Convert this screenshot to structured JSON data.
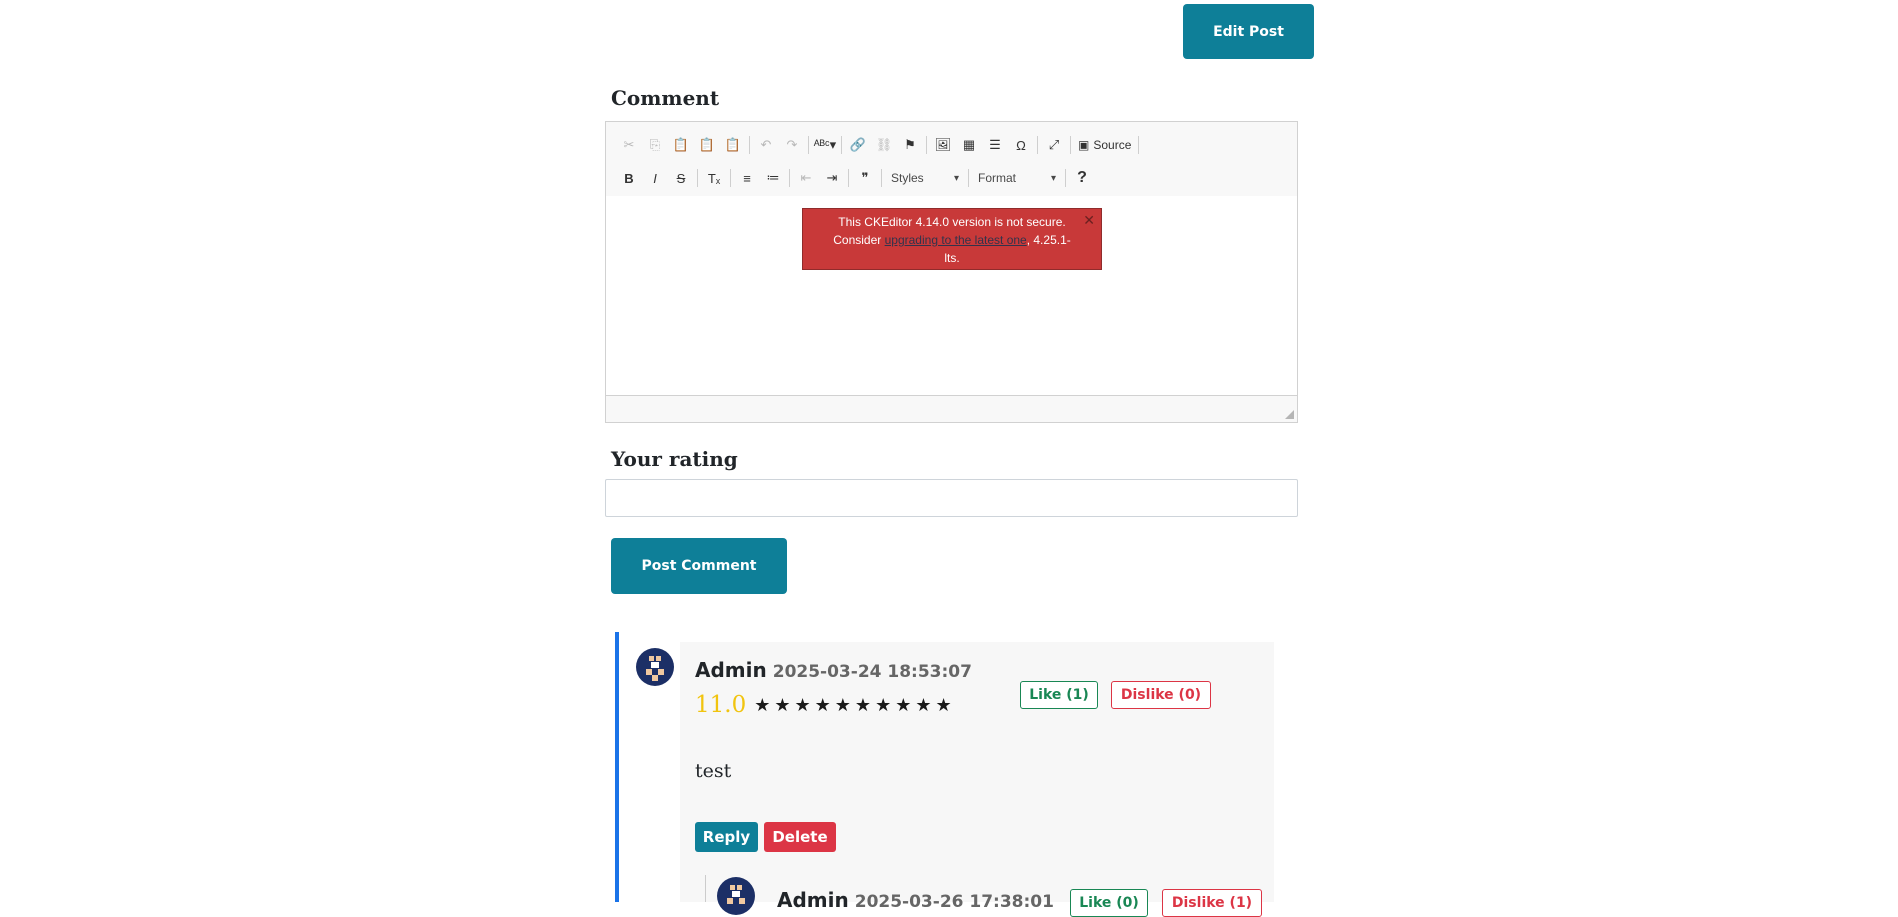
{
  "header": {
    "edit_post_label": "Edit Post"
  },
  "comment_form": {
    "comment_label": "Comment",
    "editor": {
      "toolbar_row1": [
        {
          "icon": "cut-icon",
          "glyph": "✂",
          "disabled": true
        },
        {
          "icon": "copy-icon",
          "glyph": "⎘",
          "disabled": true
        },
        {
          "icon": "paste-icon",
          "glyph": "📋",
          "disabled": false
        },
        {
          "icon": "paste-text-icon",
          "glyph": "📋",
          "disabled": false
        },
        {
          "icon": "paste-word-icon",
          "glyph": "📋",
          "disabled": false
        },
        {
          "sep": true
        },
        {
          "icon": "undo-icon",
          "glyph": "↶",
          "disabled": true
        },
        {
          "icon": "redo-icon",
          "glyph": "↷",
          "disabled": true
        },
        {
          "sep": true
        },
        {
          "icon": "spellcheck-icon",
          "glyph": "ᴬᴮᶜ▾",
          "disabled": false
        },
        {
          "sep": true
        },
        {
          "icon": "link-icon",
          "glyph": "🔗",
          "disabled": false
        },
        {
          "icon": "unlink-icon",
          "glyph": "⛓",
          "disabled": true
        },
        {
          "icon": "anchor-icon",
          "glyph": "⚑",
          "disabled": false
        },
        {
          "sep": true
        },
        {
          "icon": "image-icon",
          "glyph": "🖼",
          "disabled": false
        },
        {
          "icon": "table-icon",
          "glyph": "▦",
          "disabled": false
        },
        {
          "icon": "horizontal-line-icon",
          "glyph": "☰",
          "disabled": false
        },
        {
          "icon": "special-char-icon",
          "glyph": "Ω",
          "disabled": false
        },
        {
          "sep": true
        },
        {
          "icon": "maximize-icon",
          "glyph": "⤢",
          "disabled": false
        },
        {
          "sep": true
        }
      ],
      "source_label": "Source",
      "toolbar_row2": [
        {
          "icon": "bold-icon",
          "glyph": "B",
          "disabled": false
        },
        {
          "icon": "italic-icon",
          "glyph": "I",
          "disabled": false
        },
        {
          "icon": "strike-icon",
          "glyph": "S",
          "disabled": false
        },
        {
          "sep": true
        },
        {
          "icon": "remove-format-icon",
          "glyph": "Tₓ",
          "disabled": false
        },
        {
          "sep": true
        },
        {
          "icon": "numbered-list-icon",
          "glyph": "≡",
          "disabled": false
        },
        {
          "icon": "bulleted-list-icon",
          "glyph": "≔",
          "disabled": false
        },
        {
          "sep": true
        },
        {
          "icon": "outdent-icon",
          "glyph": "⇤",
          "disabled": true
        },
        {
          "icon": "indent-icon",
          "glyph": "⇥",
          "disabled": false
        },
        {
          "sep": true
        },
        {
          "icon": "blockquote-icon",
          "glyph": "❞",
          "disabled": false
        },
        {
          "sep": true
        }
      ],
      "styles_label": "Styles",
      "format_label": "Format",
      "help_glyph": "?",
      "notice": {
        "text_before": "This CKEditor 4.14.0 version is not secure. Consider ",
        "link_text": "upgrading to the latest one",
        "text_after": ", 4.25.1-lts.",
        "close_glyph": "✕"
      }
    },
    "rating_label": "Your rating",
    "rating_value": "",
    "post_comment_label": "Post Comment"
  },
  "comments": [
    {
      "author": "Admin",
      "date": "2025-03-24 18:53:07",
      "rating_value": "11.0",
      "stars": 10,
      "like_label": "Like (1)",
      "dislike_label": "Dislike (0)",
      "body": "test",
      "reply_label": "Reply",
      "delete_label": "Delete",
      "colors": {
        "rating": "#f1c40f",
        "like": "#198754",
        "dislike": "#dc3545",
        "accent_bar": "#1a73e8"
      }
    },
    {
      "author": "Admin",
      "date": "2025-03-26 17:38:01",
      "like_label": "Like (0)",
      "dislike_label": "Dislike (1)"
    }
  ]
}
